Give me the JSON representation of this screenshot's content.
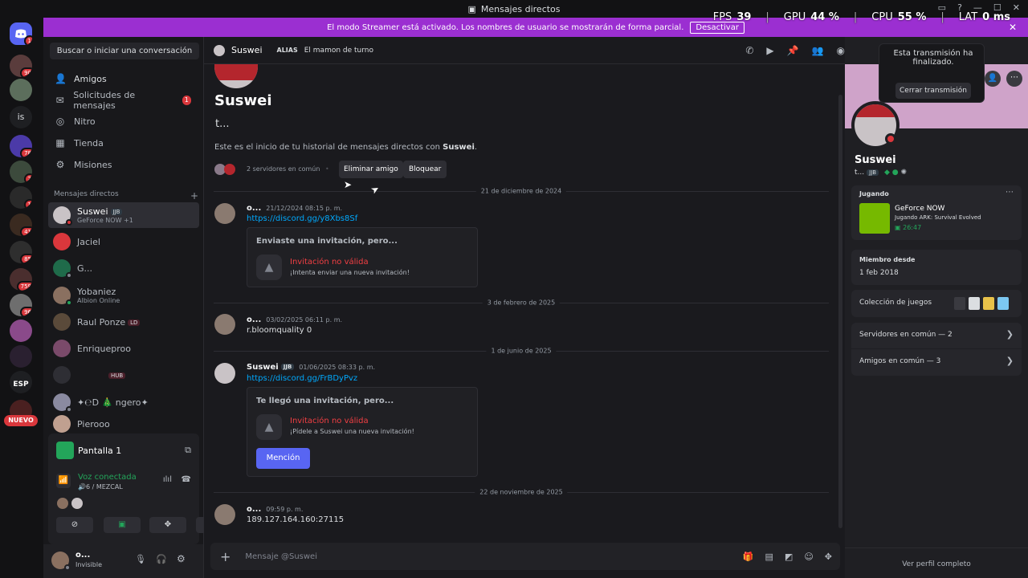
{
  "window": {
    "title": "Mensajes directos"
  },
  "banner": {
    "text": "El modo Streamer está activado. Los nombres de usuario se mostrarán de forma parcial.",
    "button": "Desactivar"
  },
  "overlay": {
    "fps_label": "FPS",
    "fps": "39",
    "gpu_label": "GPU",
    "gpu": "44 %",
    "cpu_label": "CPU",
    "cpu": "55 %",
    "lat_label": "LAT",
    "lat": "0 ms"
  },
  "rail": {
    "badges": [
      "1",
      "90",
      "78",
      "2",
      "1",
      "41",
      "85",
      "759",
      "96"
    ],
    "labels": [
      "is",
      "ESP"
    ],
    "new_label": "NUEVO"
  },
  "sidebar": {
    "search": "Buscar o iniciar una conversación",
    "nav": [
      {
        "label": "Amigos",
        "icon": "friends-icon"
      },
      {
        "label": "Solicitudes de mensajes",
        "icon": "mail-icon",
        "badge": "1"
      },
      {
        "label": "Nitro",
        "icon": "nitro-icon"
      },
      {
        "label": "Tienda",
        "icon": "shop-icon"
      },
      {
        "label": "Misiones",
        "icon": "quests-icon"
      }
    ],
    "dm_header": "Mensajes directos",
    "dm_add": "+",
    "dms": [
      {
        "name": "Suswei",
        "tag": "JJB",
        "sub": "GeForce NOW +1"
      },
      {
        "name": "Jaciel",
        "sub": ""
      },
      {
        "name": "G...",
        "sub": ""
      },
      {
        "name": "Yobaniez",
        "sub": "Albion Online"
      },
      {
        "name": "Raul Ponze",
        "tag": "LD",
        "sub": ""
      },
      {
        "name": "Enriqueproo",
        "sub": ""
      },
      {
        "name": "",
        "tag": "HUB",
        "sub": ""
      },
      {
        "name": "✦℮D 🎄 ngero✦",
        "sub": ""
      },
      {
        "name": "Pierooo",
        "sub": ""
      }
    ]
  },
  "voice": {
    "screen": "Pantalla 1",
    "status": "Voz conectada",
    "channel": "🔊6 / MEZCAL"
  },
  "user": {
    "name": "o...",
    "status": "Invisible"
  },
  "chat": {
    "header_name": "Suswei",
    "alias_label": "ALIAS",
    "alias": "El mamon de turno",
    "intro_name": "Suswei",
    "intro_sub": "t...",
    "intro_text_pre": "Este es el inicio de tu historial de mensajes directos con ",
    "intro_text_name": "Suswei",
    "intro_text_post": ".",
    "mutual": "2 servidores en común",
    "remove_friend": "Eliminar amigo",
    "block": "Bloquear",
    "dates": [
      "21 de diciembre de 2024",
      "3 de febrero de 2025",
      "1 de junio de 2025",
      "22 de noviembre de 2025"
    ],
    "messages": [
      {
        "author": "o...",
        "time": "21/12/2024 08:15 p. m.",
        "link": "https://discord.gg/y8Xbs8Sf",
        "invite": {
          "header": "Enviaste una invitación, pero...",
          "title": "Invitación no válida",
          "sub": "¡Intenta enviar una nueva invitación!"
        }
      },
      {
        "author": "o...",
        "time": "03/02/2025 06:11 p. m.",
        "text": "r.bloomquality 0"
      },
      {
        "author": "Suswei",
        "tag": "JJB",
        "time": "01/06/2025 08:33 p. m.",
        "link": "https://discord.gg/FrBDyPvz",
        "invite": {
          "header": "Te llegó una invitación, pero...",
          "title": "Invitación no válida",
          "sub": "¡Pídele a Suswei una nueva invitación!",
          "button": "Mención"
        }
      },
      {
        "author": "o...",
        "time": "09:59 p. m.",
        "text": "189.127.164.160:27115"
      }
    ],
    "composer_placeholder": "Mensaje @Suswei"
  },
  "toast": {
    "text": "Esta transmisión ha finalizado.",
    "button": "Cerrar transmisión"
  },
  "profile": {
    "name": "Suswei",
    "sub": "t...",
    "tag": "JJB",
    "playing_label": "Jugando",
    "game": "GeForce NOW",
    "game_detail": "Jugando ARK: Survival Evolved",
    "game_time": "26:47",
    "member_label": "Miembro desde",
    "member_since": "1 feb 2018",
    "collection": "Colección de juegos",
    "servers": "Servidores en común — 2",
    "friends": "Amigos en común — 3",
    "view_full": "Ver perfil completo"
  },
  "colors": {
    "accent": "#5865f2",
    "banner": "#9b2fd1",
    "danger": "#f23f43",
    "link": "#00a8fc",
    "online": "#23a55a"
  }
}
